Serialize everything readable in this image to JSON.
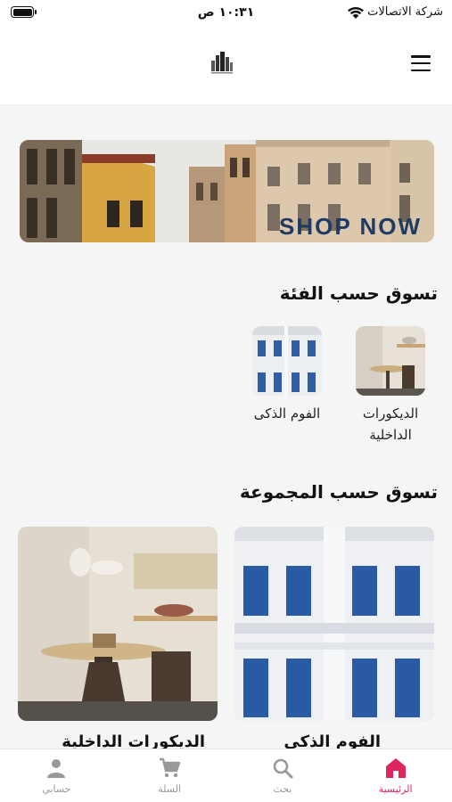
{
  "status_bar": {
    "carrier": "شركة الاتصالات",
    "time": "١٠:٣١ ص"
  },
  "header": {
    "logo_icon": "buildings-logo-icon",
    "menu_icon": "hamburger-menu-icon"
  },
  "banner": {
    "cta": "SHOP NOW"
  },
  "shop_by_category": {
    "title": "تسوق حسب الفئة",
    "items": [
      {
        "label": "الديكورات الداخلية",
        "image": "interior-decor-image"
      },
      {
        "label": "الفوم الذكى",
        "image": "smart-foam-image"
      }
    ]
  },
  "shop_by_group": {
    "title": "تسوق حسب المجموعة",
    "items": [
      {
        "label": "الفوم الذكى",
        "image": "smart-foam-facade-image"
      },
      {
        "label": "الديكورات الداخلية",
        "image": "interior-decor-room-image"
      }
    ]
  },
  "tab_bar": {
    "items": [
      {
        "label": "الرئيسية",
        "icon": "home-icon",
        "active": true
      },
      {
        "label": "بحث",
        "icon": "search-icon",
        "active": false
      },
      {
        "label": "السلة",
        "icon": "cart-icon",
        "active": false
      },
      {
        "label": "حسابي",
        "icon": "person-icon",
        "active": false
      }
    ]
  },
  "colors": {
    "accent": "#e0245e",
    "inactive": "#999999",
    "banner_text": "#1f3b63"
  }
}
